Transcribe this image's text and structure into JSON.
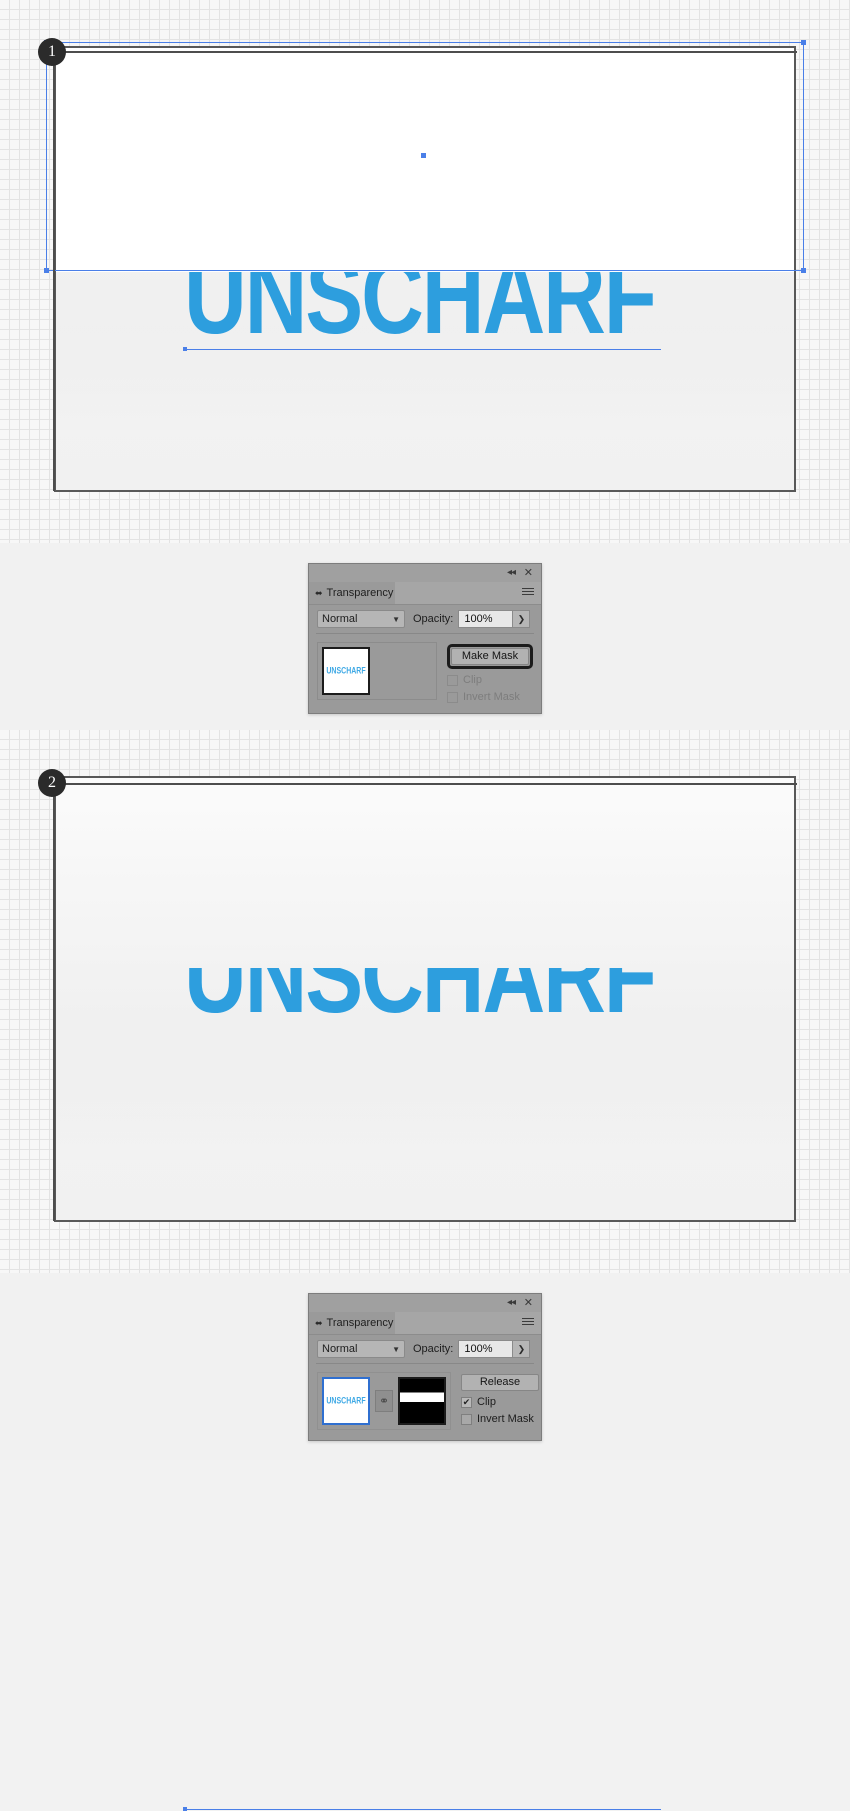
{
  "artwork": {
    "word": "UNSCHARF",
    "accent_color": "#2d9ede",
    "thumb_word": "UNSCHARF"
  },
  "steps": [
    {
      "number": "1"
    },
    {
      "number": "2"
    }
  ],
  "panel1": {
    "title": "Transparency",
    "collapse_icon": "◂◂",
    "close_icon": "✕",
    "menu_icon": "hamburger-icon",
    "panel_toggle_icon": "⬌",
    "blend_mode": "Normal",
    "blend_modes": [
      "Normal"
    ],
    "opacity_label": "Opacity:",
    "opacity_value": "100%",
    "stepper_icon": "❯",
    "action_button": "Make Mask",
    "clip_label": "Clip",
    "clip_checked": false,
    "invert_label": "Invert Mask",
    "invert_checked": false,
    "controls_enabled": false
  },
  "panel2": {
    "title": "Transparency",
    "collapse_icon": "◂◂",
    "close_icon": "✕",
    "menu_icon": "hamburger-icon",
    "panel_toggle_icon": "⬌",
    "blend_mode": "Normal",
    "blend_modes": [
      "Normal"
    ],
    "opacity_label": "Opacity:",
    "opacity_value": "100%",
    "stepper_icon": "❯",
    "action_button": "Release",
    "clip_label": "Clip",
    "clip_checked": true,
    "check_glyph": "✔",
    "invert_label": "Invert Mask",
    "invert_checked": false,
    "link_icon": "⚭",
    "controls_enabled": true
  }
}
